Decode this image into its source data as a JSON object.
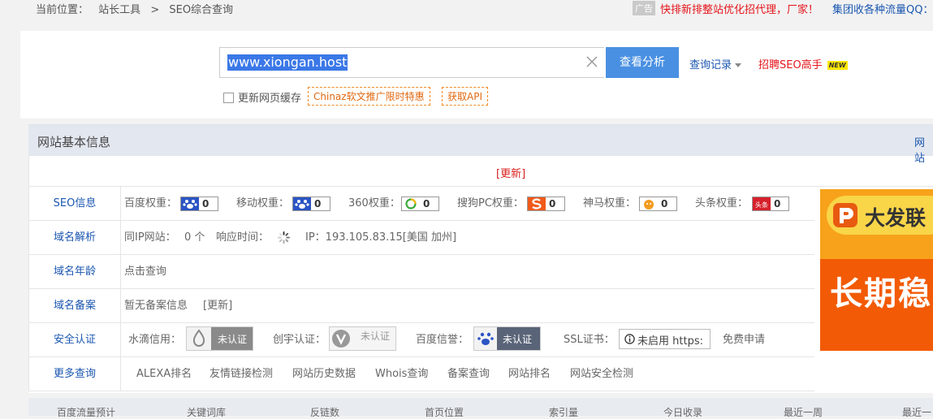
{
  "topbar": {
    "location_label": "当前位置：",
    "crumb1": "站长工具",
    "sep": ">",
    "crumb2": "SEO综合查询",
    "ad_tag": "广告",
    "ad_text": "快排新排整站优化招代理，厂家！",
    "ad_text2": "集团收各种流量QQ："
  },
  "search": {
    "value": "www.xiongan.host",
    "button": "查看分析",
    "history": "查询记录",
    "hire": "招聘SEO高手",
    "new_badge": "NEW",
    "cache_label": "更新网页缓存",
    "promo1": "Chinaz软文推广限时特惠",
    "promo2": "获取API"
  },
  "info": {
    "title": "网站基本信息",
    "right_link": "网站",
    "update": "[更新]",
    "seo": {
      "label": "SEO信息",
      "items": [
        {
          "label": "百度权重：",
          "value": "0",
          "icon": "paw-icon"
        },
        {
          "label": "移动权重：",
          "value": "0",
          "icon": "paw-icon"
        },
        {
          "label": "360权重：",
          "value": "0",
          "icon": "360-icon"
        },
        {
          "label": "搜狗PC权重：",
          "value": "0",
          "icon": "sogou-icon"
        },
        {
          "label": "神马权重：",
          "value": "0",
          "icon": "shenma-icon"
        },
        {
          "label": "头条权重：",
          "value": "0",
          "icon": "toutiao-icon"
        }
      ],
      "toutiao_icon_text": "头条"
    },
    "dns": {
      "label": "域名解析",
      "same_ip_label": "同IP网站：",
      "same_ip_value": "0 个",
      "resp_label": "响应时间：",
      "ip": "IP：193.105.83.15[美国 加州]"
    },
    "age": {
      "label": "域名年龄",
      "link": "点击查询"
    },
    "icp": {
      "label": "域名备案",
      "text": "暂无备案信息",
      "update": "[更新]"
    },
    "security": {
      "label": "安全认证",
      "shuidi_label": "水滴信用：",
      "shuidi_badge": "未认证",
      "chuangyu_label": "创宇认证：",
      "chuangyu_badge": "未认证",
      "baidu_label": "百度信誉：",
      "baidu_badge": "未认证",
      "ssl_label": "SSL证书：",
      "ssl_value": "未启用 https:",
      "ssl_apply": "免费申请"
    },
    "more": {
      "label": "更多查询",
      "links": [
        "ALEXA排名",
        "友情链接检测",
        "网站历史数据",
        "Whois查询",
        "备案查询",
        "网站排名",
        "网站安全检测"
      ]
    }
  },
  "ad": {
    "logo_text": "大发联",
    "big_text": "长期稳"
  },
  "bottom": [
    "百度流量预计",
    "关键词库",
    "反链数",
    "首页位置",
    "索引量",
    "今日收录",
    "最近一周",
    "最近一"
  ]
}
